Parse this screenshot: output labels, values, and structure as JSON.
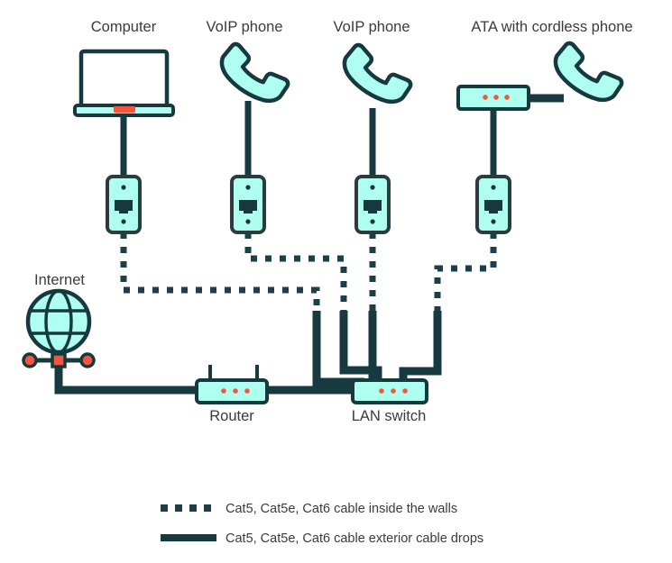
{
  "diagram": {
    "title_labels": {
      "computer": "Computer",
      "voip_phone_1": "VoIP phone",
      "voip_phone_2": "VoIP phone",
      "ata": "ATA with cordless phone"
    },
    "node_labels": {
      "internet": "Internet",
      "router": "Router",
      "lan_switch": "LAN switch"
    },
    "legend": [
      {
        "style": "dashed",
        "label": "Cat5, Cat5e, Cat6 cable inside the walls"
      },
      {
        "style": "solid",
        "label": "Cat5, Cat5e, Cat6 cable exterior cable drops"
      }
    ],
    "icons": {
      "laptop": "laptop-icon",
      "handset": "telephone-handset-icon",
      "wall_jack": "rj45-wall-jack-icon",
      "globe": "internet-globe-icon",
      "router": "router-icon",
      "switch": "lan-switch-icon",
      "ata": "ata-adapter-icon"
    },
    "colors": {
      "mint": "#AFFFF0",
      "outline": "#15393E",
      "dark_stroke": "#173a40",
      "accent_red": "#F4553F",
      "text": "#3b3b3b",
      "screen": "#ffffff",
      "background": "#ffffff"
    },
    "led_counts": {
      "router": 3,
      "lan_switch": 3,
      "ata": 3
    }
  }
}
